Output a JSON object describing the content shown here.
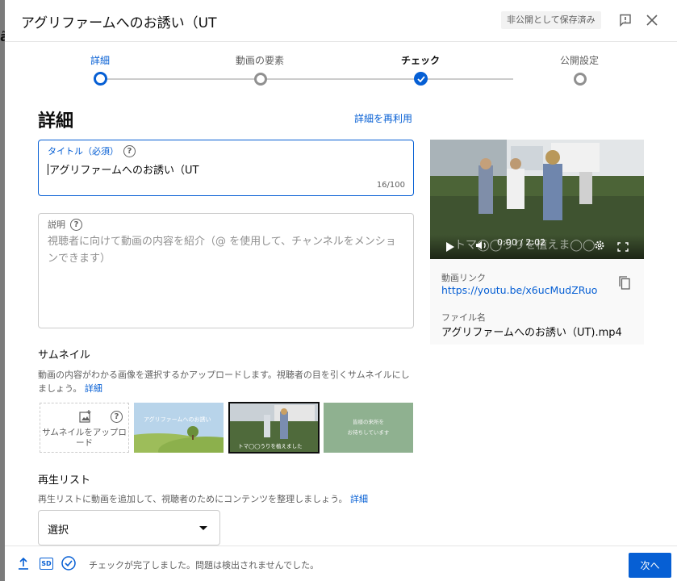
{
  "header": {
    "title": "アグリファームへのお誘い（UT",
    "save_status": "非公開として保存済み"
  },
  "stepper": {
    "steps": [
      {
        "label": "詳細",
        "state": "current"
      },
      {
        "label": "動画の要素",
        "state": "pending"
      },
      {
        "label": "チェック",
        "state": "done"
      },
      {
        "label": "公開設定",
        "state": "pending"
      }
    ]
  },
  "details": {
    "heading": "詳細",
    "reuse_link": "詳細を再利用",
    "title_field": {
      "label": "タイトル（必須）",
      "value": "アグリファームへのお誘い（UT",
      "counter": "16/100"
    },
    "description_field": {
      "label": "説明",
      "placeholder": "視聴者に向けて動画の内容を紹介（@ を使用して、チャンネルをメンションできます）"
    }
  },
  "thumbnail": {
    "heading": "サムネイル",
    "description": "動画の内容がわかる画像を選択するかアップロードします。視聴者の目を引くサムネイルにしましょう。",
    "more_link": "詳細",
    "upload_label": "サムネイルをアップロード",
    "options": [
      {
        "caption": "アグリファームへのお誘い"
      },
      {
        "caption": "トマ◯◯うりを植えました"
      },
      {
        "caption_line1": "皆様の来所を",
        "caption_line2": "お待ちしています"
      }
    ]
  },
  "playlist": {
    "heading": "再生リスト",
    "description": "再生リストに動画を追加して、視聴者のためにコンテンツを整理しましょう。",
    "more_link": "詳細",
    "select_value": "選択"
  },
  "side_panel": {
    "overlay_text": "トマ◯◯うりを植えま◯◯",
    "time": "0:00 / 2:02",
    "link_label": "動画リンク",
    "link_url": "https://youtu.be/x6ucMudZRuo",
    "file_label": "ファイル名",
    "file_name": "アグリファームへのお誘い（UT).mp4"
  },
  "footer": {
    "status_message": "チェックが完了しました。問題は検出されませんでした。",
    "next_label": "次へ",
    "sd_badge": "SD"
  }
}
